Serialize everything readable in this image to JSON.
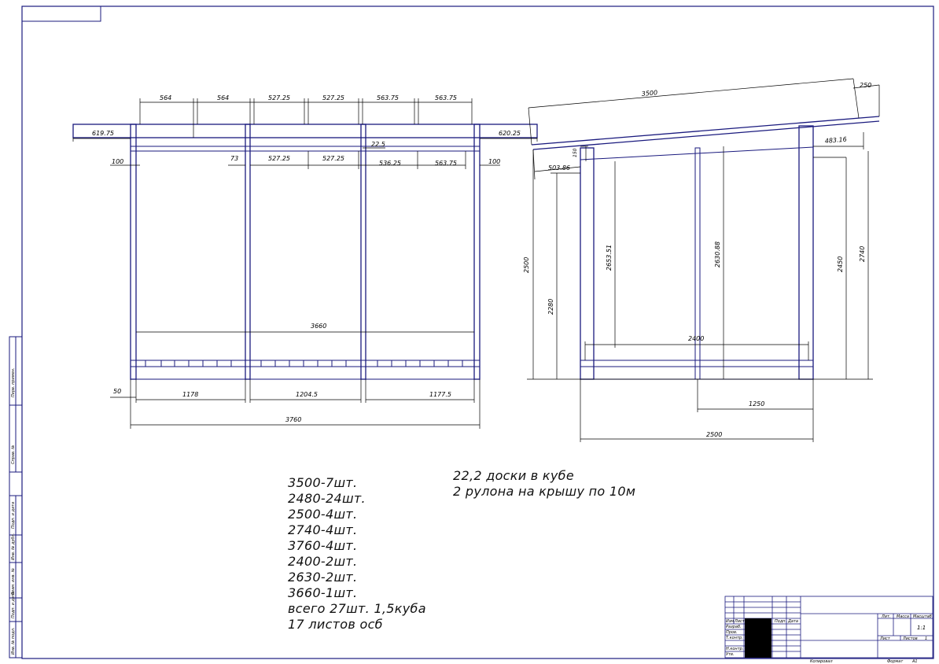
{
  "colors": {
    "frame": "#1a1a7e",
    "dim": "#000000",
    "stamp_fill": "#000000"
  },
  "front_view": {
    "dims_top": [
      "564",
      "564",
      "527.25",
      "527.25",
      "563.75",
      "563.75"
    ],
    "overhang_left": "619.75",
    "overhang_right": "620.25",
    "dims_second": [
      "73",
      "527.25",
      "527.25",
      "536.25",
      "563.75"
    ],
    "small_offset": "22.5",
    "edge_left": "100",
    "edge_right": "100",
    "inner_width": "3660",
    "bottom_offset": "50",
    "bay_widths": [
      "1178",
      "1204.5",
      "1177.5"
    ],
    "total_width": "3760"
  },
  "side_view": {
    "rafter_length": "3500",
    "rafter_tip": "250",
    "left_overhang": "503.86",
    "left_post_gap": "150",
    "right_overhang": "483.16",
    "height_left_outer": "2500",
    "height_left_inner": "2280",
    "height_post_1": "2653.51",
    "height_post_2": "2630.88",
    "height_right_inner": "2450",
    "height_right_outer": "2740",
    "inner_span": "2400",
    "half_span": "1250",
    "total_span": "2500"
  },
  "materials_list": [
    "3500-7шт.",
    "2480-24шт.",
    "2500-4шт.",
    "2740-4шт.",
    "3760-4шт.",
    "2400-2шт.",
    "2630-2шт.",
    "3660-1шт.",
    "всего 27шт. 1,5куба",
    "17 листов осб"
  ],
  "notes": [
    "22,2 доски в кубе",
    "2 рулона на крышу по 10м"
  ],
  "title_block": {
    "col_izm": "Изм",
    "col_list": "Лист",
    "col_doc": "№ докум.",
    "col_sign": "Подп.",
    "col_date": "Дата",
    "row_razrab": "Разраб.",
    "row_prov": "Пров.",
    "row_tkontr": "Т.контр.",
    "row_nkontr": "Н.контр.",
    "row_utv": "Утв.",
    "lit": "Лит.",
    "mass": "Масса",
    "scale": "Масштаб",
    "scale_value": "1:1",
    "sheet": "Лист",
    "sheets": "Листов",
    "sheets_value": "1",
    "copied": "Копировал",
    "format": "Формат",
    "format_value": "А1"
  },
  "side_strip": {
    "labels": [
      "Перв. примен.",
      "Справ. №",
      "Подп. и дата",
      "Инв. № дубл.",
      "Взам. инв. №",
      "Подп. и дата",
      "Инв. № подл."
    ]
  }
}
